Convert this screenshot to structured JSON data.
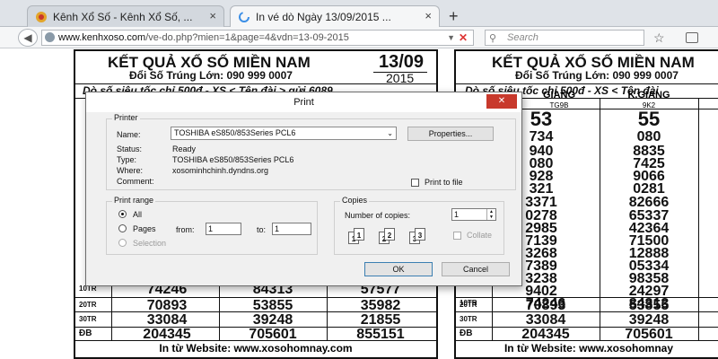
{
  "browser": {
    "tabs": [
      {
        "label": "Kênh Xổ Số - Kênh Xổ Số, ...",
        "close": "×"
      },
      {
        "label": "In vé dò Ngày 13/09/2015 ...",
        "close": "×"
      }
    ],
    "new_tab": "+",
    "url_host": "www.kenhxoso.com",
    "url_path": "/ve-do.php?mien=1&page=4&vdn=13-09-2015",
    "search_placeholder": "Search"
  },
  "ticket_left": {
    "title": "KẾT QUẢ XỔ SỐ MIỀN NAM",
    "date": "13/09",
    "year": "2015",
    "phone": "Đổi Số Trúng Lớn: 090 999 0007",
    "info": "Dò số siêu tốc chỉ 500đ - XS < Tên đài > gửi 6089",
    "rows": [
      {
        "label": "10TR",
        "values": [
          "74246",
          "84313",
          "57577"
        ]
      },
      {
        "label": "20TR",
        "values": [
          "70893",
          "53855",
          "35982"
        ]
      },
      {
        "label": "30TR",
        "values": [
          "33084",
          "39248",
          "21855"
        ]
      },
      {
        "label": "ĐB",
        "values": [
          "204345",
          "705601",
          "855151"
        ]
      }
    ],
    "footer": "In từ Website: www.xosohomnay.com"
  },
  "ticket_right": {
    "title": "KẾT QUẢ XỔ SỐ MIỀN NAM",
    "phone": "Đổi Số Trúng Lớn: 090 999 0007",
    "info": "Dò số siêu tốc chỉ 500đ - XS < Tên đài",
    "col1_head": "GIANG",
    "col1_code": "TG9B",
    "col2_head": "K.GIANG",
    "col2_code": "9K2",
    "col1_values": [
      "53",
      "734",
      "940",
      "080",
      "928",
      "321",
      "3371",
      "0278",
      "2985",
      "7139",
      "3268",
      "7389",
      "3238",
      "9402"
    ],
    "col2_values": [
      "55",
      "080",
      "8835",
      "7425",
      "9066",
      "0281",
      "82666",
      "65337",
      "42364",
      "71500",
      "12888",
      "05334",
      "98358",
      "24297"
    ],
    "rows": [
      {
        "label": "10TR",
        "values": [
          "74246",
          "84313"
        ]
      },
      {
        "label": "20TR",
        "values": [
          "70893",
          "53855"
        ]
      },
      {
        "label": "30TR",
        "values": [
          "33084",
          "39248"
        ]
      },
      {
        "label": "ĐB",
        "values": [
          "204345",
          "705601"
        ]
      }
    ],
    "footer": "In từ Website: www.xosohomnay"
  },
  "print_dialog": {
    "title": "Print",
    "close": "✕",
    "printer_group": "Printer",
    "name_label": "Name:",
    "printer_name": "TOSHIBA eS850/853Series PCL6",
    "properties_button": "Properties...",
    "status_label": "Status:",
    "status_value": "Ready",
    "type_label": "Type:",
    "type_value": "TOSHIBA eS850/853Series PCL6",
    "where_label": "Where:",
    "where_value": "xosominhchinh.dyndns.org",
    "comment_label": "Comment:",
    "print_to_file": "Print to file",
    "range_group": "Print range",
    "all_label": "All",
    "pages_label": "Pages",
    "from_label": "from:",
    "from_value": "1",
    "to_label": "to:",
    "to_value": "1",
    "selection_label": "Selection",
    "copies_group": "Copies",
    "number_of_copies_label": "Number of copies:",
    "copies_value": "1",
    "collate_label": "Collate",
    "ok_button": "OK",
    "cancel_button": "Cancel"
  }
}
